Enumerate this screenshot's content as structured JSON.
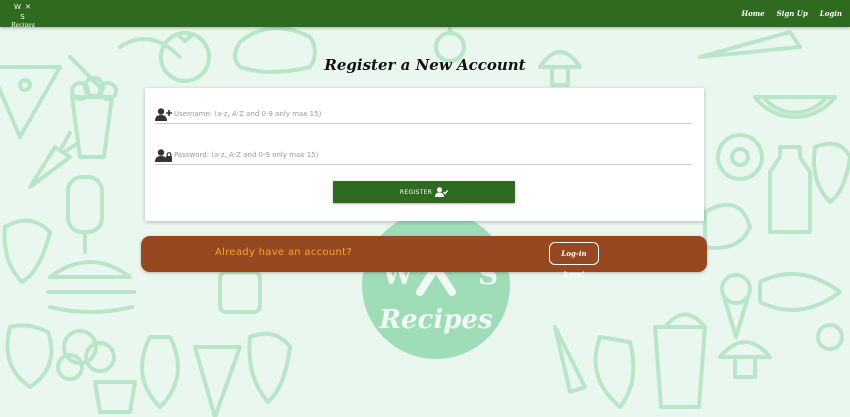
{
  "nav": {
    "brand_mark": "W ✕ S",
    "brand_text": "Recipes",
    "links": [
      "Home",
      "Sign Up",
      "Login"
    ]
  },
  "page": {
    "title": "Register a New Account"
  },
  "form": {
    "username": {
      "placeholder": "Username: (a-z, A-Z and 0-9 only max 15)",
      "value": "",
      "icon": "user-plus-icon"
    },
    "password": {
      "placeholder": "Password: (a-z, A-Z and 0-9 only max 15)",
      "value": "",
      "icon": "user-lock-icon"
    },
    "submit": {
      "label": "REGISTER",
      "icon": "user-check-icon"
    }
  },
  "login_banner": {
    "question": "Already have an account?",
    "link_label": "Log-in here!"
  },
  "watermark": {
    "mark": "W ✕ S",
    "text": "Recipes"
  },
  "colors": {
    "navbar": "#2e6a1f",
    "button": "#2e6a1f",
    "banner": "#964820",
    "banner_text": "#f5a623",
    "background": "#eaf7ef",
    "doodle": "#b9e6c8"
  }
}
